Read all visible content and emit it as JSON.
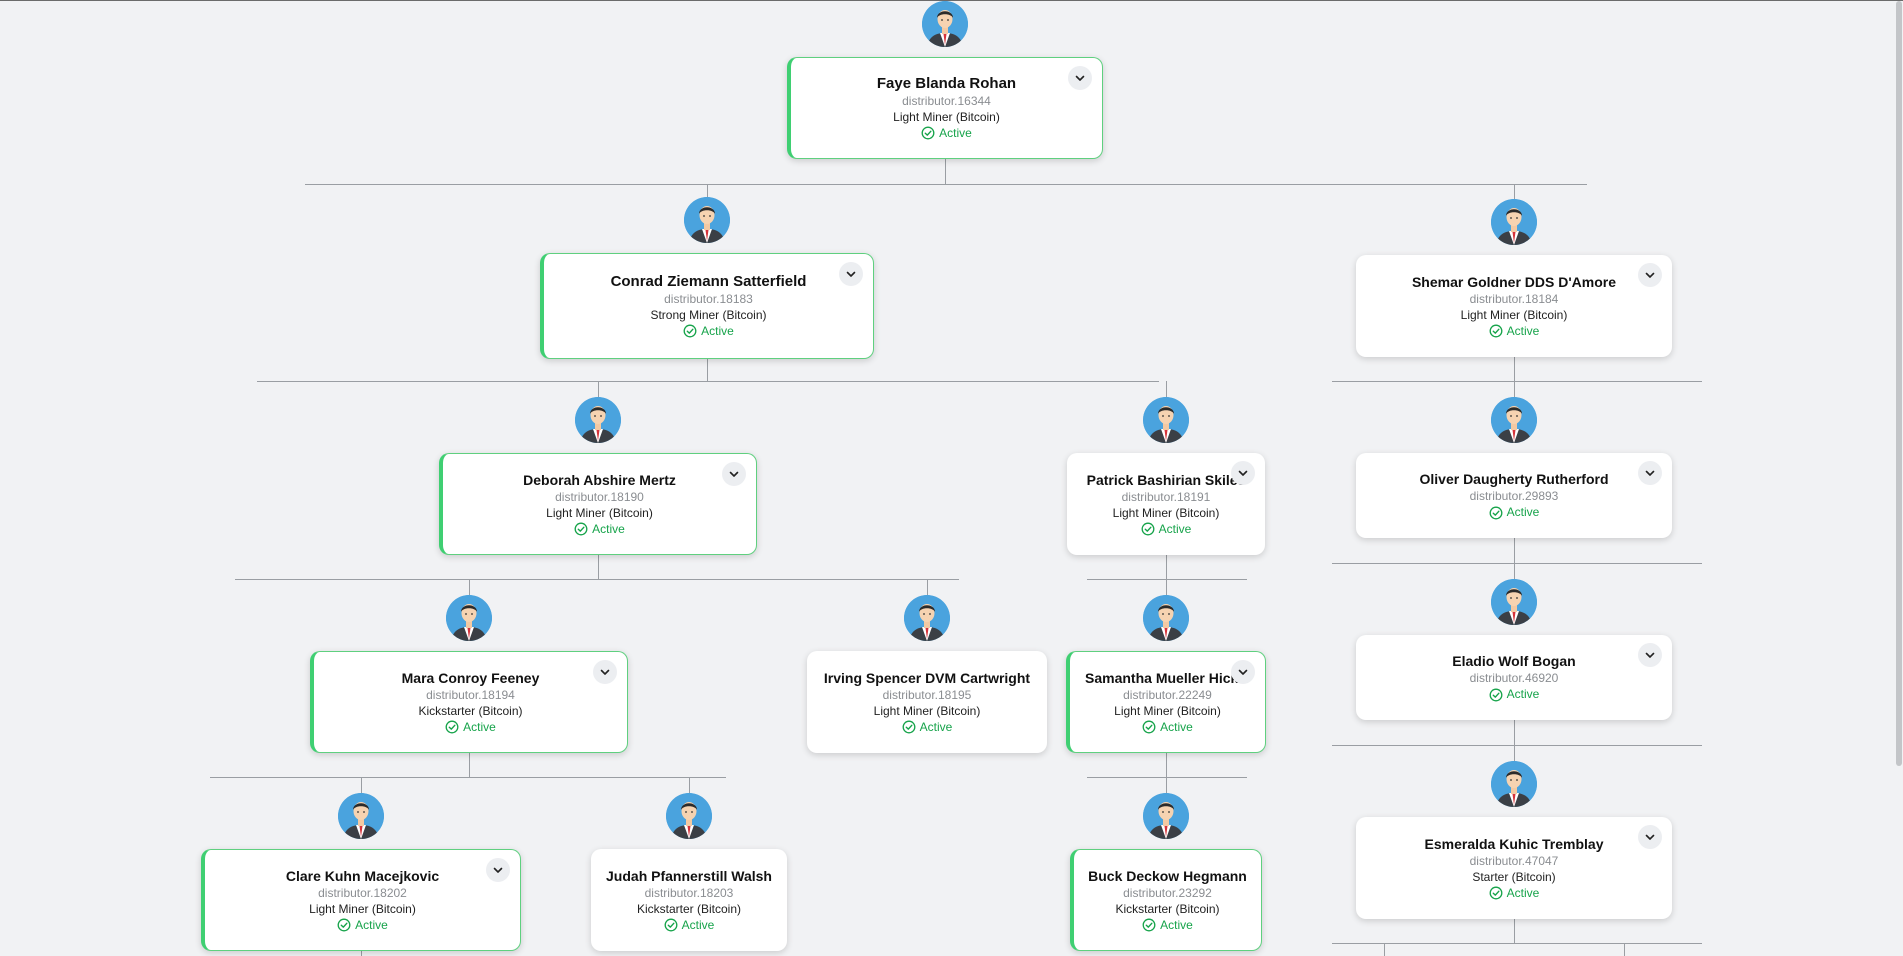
{
  "members": [
    {
      "id": "faye",
      "name": "Faye Blanda Rohan",
      "username": "distributor.16344",
      "rank": "Light Miner (Bitcoin)",
      "status": "Active",
      "highlighted": true,
      "expandable": true
    },
    {
      "id": "conrad",
      "name": "Conrad Ziemann Satterfield",
      "username": "distributor.18183",
      "rank": "Strong Miner (Bitcoin)",
      "status": "Active",
      "highlighted": true,
      "expandable": true
    },
    {
      "id": "shemar",
      "name": "Shemar Goldner DDS D'Amore",
      "username": "distributor.18184",
      "rank": "Light Miner (Bitcoin)",
      "status": "Active",
      "highlighted": false,
      "expandable": true
    },
    {
      "id": "deborah",
      "name": "Deborah Abshire Mertz",
      "username": "distributor.18190",
      "rank": "Light Miner (Bitcoin)",
      "status": "Active",
      "highlighted": true,
      "expandable": true
    },
    {
      "id": "patrick",
      "name": "Patrick Bashirian Skiles",
      "username": "distributor.18191",
      "rank": "Light Miner (Bitcoin)",
      "status": "Active",
      "highlighted": false,
      "expandable": true
    },
    {
      "id": "oliver",
      "name": "Oliver Daugherty Rutherford",
      "username": "distributor.29893",
      "rank": "",
      "status": "Active",
      "highlighted": false,
      "expandable": true
    },
    {
      "id": "eladio",
      "name": "Eladio Wolf Bogan",
      "username": "distributor.46920",
      "rank": "",
      "status": "Active",
      "highlighted": false,
      "expandable": true
    },
    {
      "id": "mara",
      "name": "Mara Conroy Feeney",
      "username": "distributor.18194",
      "rank": "Kickstarter (Bitcoin)",
      "status": "Active",
      "highlighted": true,
      "expandable": true
    },
    {
      "id": "irving",
      "name": "Irving Spencer DVM Cartwright",
      "username": "distributor.18195",
      "rank": "Light Miner (Bitcoin)",
      "status": "Active",
      "highlighted": false,
      "expandable": false
    },
    {
      "id": "samantha",
      "name": "Samantha Mueller Hickle",
      "username": "distributor.22249",
      "rank": "Light Miner (Bitcoin)",
      "status": "Active",
      "highlighted": true,
      "expandable": true
    },
    {
      "id": "esmeralda",
      "name": "Esmeralda Kuhic Tremblay",
      "username": "distributor.47047",
      "rank": "Starter (Bitcoin)",
      "status": "Active",
      "highlighted": false,
      "expandable": true
    },
    {
      "id": "clare",
      "name": "Clare Kuhn Macejkovic",
      "username": "distributor.18202",
      "rank": "Light Miner (Bitcoin)",
      "status": "Active",
      "highlighted": true,
      "expandable": true
    },
    {
      "id": "judah",
      "name": "Judah Pfannerstill Walsh",
      "username": "distributor.18203",
      "rank": "Kickstarter (Bitcoin)",
      "status": "Active",
      "highlighted": false,
      "expandable": false
    },
    {
      "id": "buck",
      "name": "Buck Deckow Hegmann",
      "username": "distributor.23292",
      "rank": "Kickstarter (Bitcoin)",
      "status": "Active",
      "highlighted": true,
      "expandable": false
    }
  ],
  "icons": {
    "avatar": "person-avatar-icon",
    "expand": "chevron-down-icon",
    "status": "check-circle-icon"
  },
  "colors": {
    "background": "#f1f2f4",
    "accent_border": "#3fcf72",
    "active_text": "#16a34a",
    "avatar_bg": "#4aa3de",
    "connector": "#9a9ea3"
  }
}
